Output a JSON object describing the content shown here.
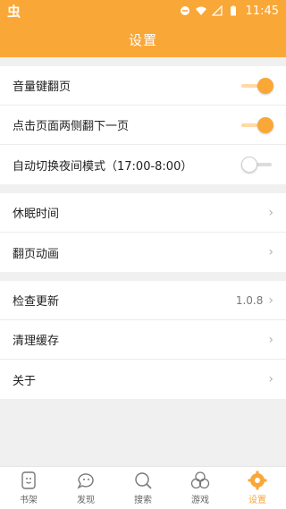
{
  "status": {
    "app_logo": "虫",
    "time": "11:45"
  },
  "header": {
    "title": "设置"
  },
  "settings": {
    "group1": [
      {
        "label": "音量键翻页",
        "toggle": "on"
      },
      {
        "label": "点击页面两侧翻下一页",
        "toggle": "on"
      },
      {
        "label": "自动切换夜间模式（17:00-8:00）",
        "toggle": "off"
      }
    ],
    "group2": [
      {
        "label": "休眠时间"
      },
      {
        "label": "翻页动画"
      }
    ],
    "group3": [
      {
        "label": "检查更新",
        "value": "1.0.8"
      },
      {
        "label": "清理缓存"
      },
      {
        "label": "关于"
      }
    ]
  },
  "nav": {
    "items": [
      {
        "label": "书架",
        "icon": "bookshelf-icon"
      },
      {
        "label": "发现",
        "icon": "discover-icon"
      },
      {
        "label": "搜索",
        "icon": "search-icon"
      },
      {
        "label": "游戏",
        "icon": "games-icon"
      },
      {
        "label": "设置",
        "icon": "settings-gear-icon",
        "active": true
      }
    ]
  },
  "colors": {
    "accent": "#f9a737",
    "background": "#f0f0f0"
  }
}
